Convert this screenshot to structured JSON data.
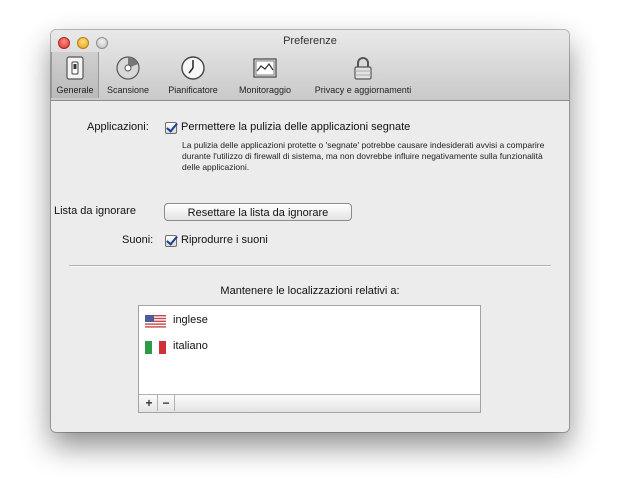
{
  "window": {
    "title": "Preferenze"
  },
  "toolbar": {
    "tabs": [
      {
        "label": "Generale",
        "icon": "switch-icon",
        "selected": true
      },
      {
        "label": "Scansione",
        "icon": "disk-icon",
        "selected": false
      },
      {
        "label": "Pianificatore",
        "icon": "clock-icon",
        "selected": false
      },
      {
        "label": "Monitoraggio",
        "icon": "monitor-icon",
        "selected": false
      },
      {
        "label": "Privacy e aggiornamenti",
        "icon": "lock-icon",
        "selected": false
      }
    ]
  },
  "general": {
    "apps_label": "Applicazioni:",
    "apps_checkbox_label": "Permettere la pulizia delle applicazioni segnate",
    "apps_checked": true,
    "apps_description": "La pulizia delle applicazioni protette o 'segnate' potrebbe causare indesiderati avvisi a comparire durante l'utilizzo di firewall di sistema, ma non dovrebbe influire negativamente sulla funzionalità delle applicazioni.",
    "ignore_list_label": "Lista da ignorare",
    "reset_button_label": "Resettare la lista da ignorare",
    "sounds_label": "Suoni:",
    "sounds_checkbox_label": "Riprodurre i suoni",
    "sounds_checked": true
  },
  "localizations": {
    "heading": "Mantenere le localizzazioni relativi a:",
    "items": [
      {
        "label": "inglese",
        "flag": "us-flag-icon"
      },
      {
        "label": "italiano",
        "flag": "italy-flag-icon"
      }
    ],
    "add_label": "+",
    "remove_label": "−"
  },
  "colors": {
    "checkmark": "#1c3f8c",
    "window_bg": "#ececec"
  }
}
